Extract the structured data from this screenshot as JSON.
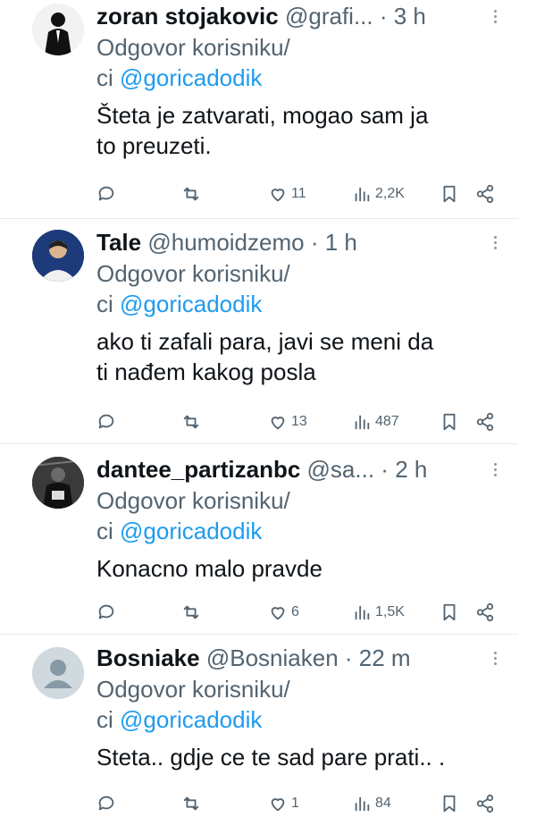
{
  "tweets": [
    {
      "name": "zoran stojakovic",
      "handle": "@grafi...",
      "time": "3 h",
      "reply_prefix": "Odgovor korisniku/",
      "reply_prefix2": "ci ",
      "mention": "@goricadodik",
      "text_lines": [
        "Šteta je zatvarati, mogao sam ja",
        "to preuzeti."
      ],
      "likes": "11",
      "views": "2,2K",
      "avatar": "man-in-suit-avatar"
    },
    {
      "name": "Tale",
      "handle": "@humoidzemo",
      "time": "1 h",
      "reply_prefix": "Odgovor korisniku/",
      "reply_prefix2": "ci ",
      "mention": "@goricadodik",
      "text_lines": [
        "ako ti zafali para, javi se meni da",
        "ti nađem kakog posla"
      ],
      "likes": "13",
      "views": "487",
      "avatar": "man-portrait-avatar"
    },
    {
      "name": "dantee_partizanbc",
      "handle": "@sa...",
      "time": "2 h",
      "reply_prefix": "Odgovor korisniku/",
      "reply_prefix2": "ci ",
      "mention": "@goricadodik",
      "text_lines": [
        "Konacno malo pravde"
      ],
      "likes": "6",
      "views": "1,5K",
      "avatar": "basketball-avatar"
    },
    {
      "name": "Bosniake",
      "handle": "@Bosniaken",
      "time": "22 m",
      "reply_prefix": "Odgovor korisniku/",
      "reply_prefix2": "ci ",
      "mention": "@goricadodik",
      "text_lines": [
        "Steta.. gdje ce te sad pare prati.. ."
      ],
      "likes": "1",
      "views": "84",
      "avatar": "default-user-avatar"
    }
  ],
  "colors": {
    "accent": "#1d9bf0",
    "muted": "#536471",
    "text": "#0f1419",
    "divider": "#e6ecf0"
  }
}
